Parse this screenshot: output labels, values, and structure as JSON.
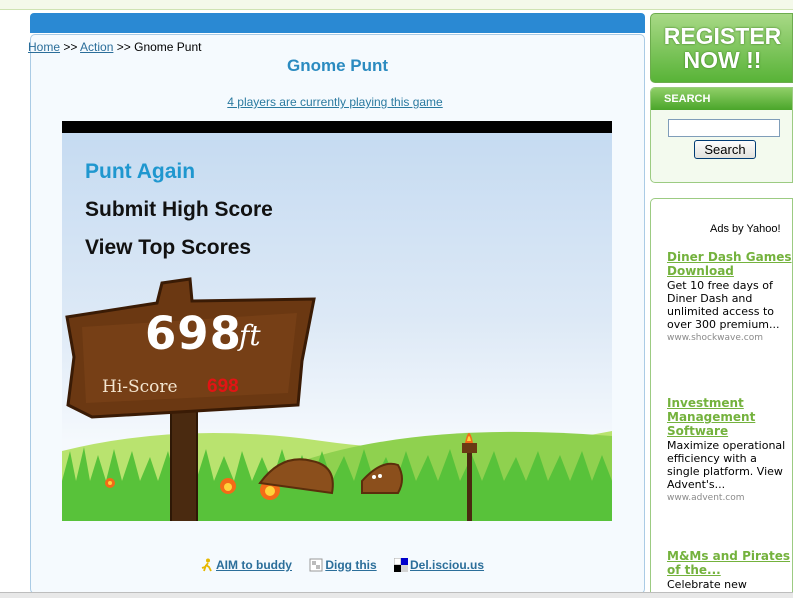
{
  "breadcrumb": {
    "home": "Home",
    "sep1": ">>",
    "category": "Action",
    "sep2": ">>",
    "current": "Gnome Punt"
  },
  "game": {
    "title": "Gnome Punt",
    "players_text": "4 players are currently playing this game",
    "menu": {
      "punt_again": "Punt Again",
      "submit_high_score": "Submit High Score",
      "view_top_scores": "View Top Scores"
    },
    "score": "698",
    "unit": "ft",
    "hi_score_label": "Hi-Score",
    "hi_score_value": "698"
  },
  "share": {
    "aim": "AIM to buddy",
    "digg": "Digg this",
    "delicious": "Del.isciou.us"
  },
  "sidebar": {
    "register_line1": "REGISTER",
    "register_line2": "NOW !!",
    "search_header": "SEARCH",
    "search_value": "",
    "search_button": "Search",
    "ads_by": "Ads by Yahoo!",
    "ads": [
      {
        "title": "Diner Dash Games Download",
        "desc": "Get 10 free days of Diner Dash and unlimited access to over 300 premium...",
        "url": "www.shockwave.com"
      },
      {
        "title": "Investment Management Software",
        "desc": "Maximize operational efficiency with a single platform. View Advent's...",
        "url": "www.advent.com"
      },
      {
        "title": "M&Ms and Pirates of the...",
        "desc": "Celebrate new",
        "url": ""
      }
    ]
  },
  "colors": {
    "main_bar": "#2a89d3",
    "link": "#2b6e9a",
    "title": "#2b8bc0",
    "sidebar_green": "#58b337",
    "ad_title": "#74b23d",
    "hi_score": "#e21414"
  }
}
